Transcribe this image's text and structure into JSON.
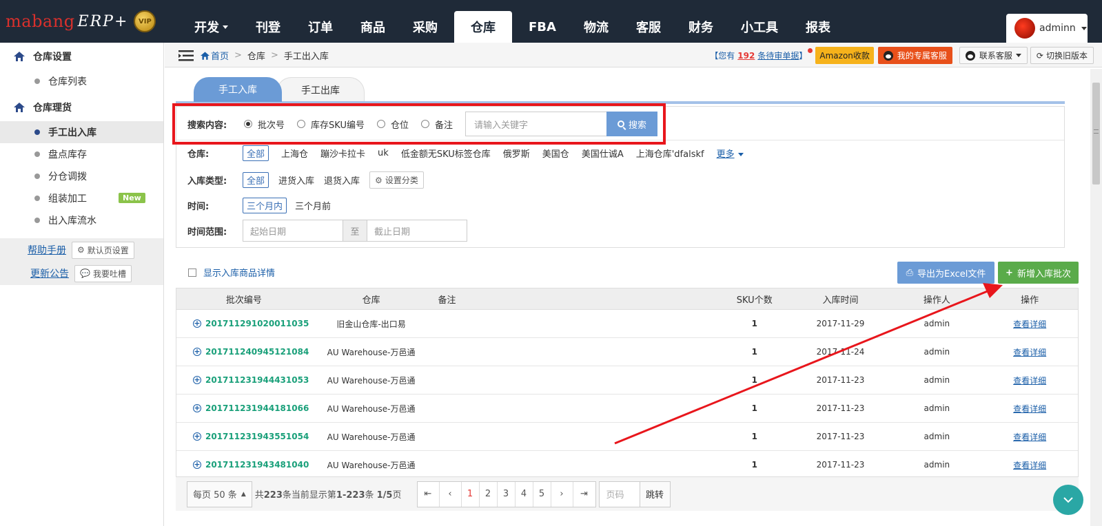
{
  "logo": {
    "brand": "mabang",
    "erp": "ERP+",
    "vip": "VIP"
  },
  "nav": {
    "items": [
      {
        "label": "开发",
        "dropdown": true
      },
      {
        "label": "刊登"
      },
      {
        "label": "订单"
      },
      {
        "label": "商品"
      },
      {
        "label": "采购"
      },
      {
        "label": "仓库",
        "active": true
      },
      {
        "label": "FBA"
      },
      {
        "label": "物流"
      },
      {
        "label": "客服"
      },
      {
        "label": "财务"
      },
      {
        "label": "小工具"
      },
      {
        "label": "报表"
      }
    ],
    "user": "adminn"
  },
  "sidebar": {
    "group1": "仓库设置",
    "group1_items": [
      "仓库列表"
    ],
    "group2": "仓库理货",
    "group2_items": [
      "手工出入库",
      "盘点库存",
      "分仓调拨",
      "组装加工",
      "出入库流水"
    ],
    "new_badge": "New",
    "help": "帮助手册",
    "default_page": "默认页设置",
    "notice": "更新公告",
    "feedback": "我要吐槽"
  },
  "breadcrumb": {
    "home": "首页",
    "level1": "仓库",
    "level2": "手工出入库"
  },
  "topright": {
    "pending_prefix": "【您有",
    "pending_count": "192",
    "pending_suffix": "条待审单据",
    "pending_close": "】",
    "amazon": "Amazon收款",
    "service": "我的专属客服",
    "contact": "联系客服",
    "old_version": "切换旧版本"
  },
  "tabs": {
    "in": "手工入库",
    "out": "手工出库"
  },
  "filters": {
    "search_label": "搜索内容:",
    "search_options": [
      "批次号",
      "库存SKU编号",
      "仓位",
      "备注"
    ],
    "search_selected": "批次号",
    "search_placeholder": "请输入关键字",
    "search_button": "搜索",
    "warehouse_label": "仓库:",
    "warehouses": [
      "全部",
      "上海仓",
      "蹦沙卡拉卡",
      "uk",
      "低金额无SKU标签仓库",
      "俄罗斯",
      "美国仓",
      "美国仕诚A",
      "上海仓库'dfalskf"
    ],
    "warehouse_more": "更多",
    "type_label": "入库类型:",
    "types": [
      "全部",
      "进货入库",
      "退货入库"
    ],
    "type_setting": "设置分类",
    "time_label": "时间:",
    "times": [
      "三个月内",
      "三个月前"
    ],
    "range_label": "时间范围:",
    "start_placeholder": "起始日期",
    "to": "至",
    "end_placeholder": "截止日期"
  },
  "actions": {
    "show_detail": "显示入库商品详情",
    "export": "导出为Excel文件",
    "add_batch": "新增入库批次"
  },
  "table": {
    "columns": [
      "批次编号",
      "仓库",
      "备注",
      "SKU个数",
      "入库时间",
      "操作人",
      "操作"
    ],
    "rows": [
      {
        "batch": "201711291020011035",
        "warehouse": "旧金山仓库-出口易",
        "note": "",
        "sku": "1",
        "time": "2017-11-29",
        "operator": "admin",
        "action": "查看详细"
      },
      {
        "batch": "201711240945121084",
        "warehouse": "AU Warehouse-万邑通",
        "note": "",
        "sku": "1",
        "time": "2017-11-24",
        "operator": "admin",
        "action": "查看详细"
      },
      {
        "batch": "201711231944431053",
        "warehouse": "AU Warehouse-万邑通",
        "note": "",
        "sku": "1",
        "time": "2017-11-23",
        "operator": "admin",
        "action": "查看详细"
      },
      {
        "batch": "201711231944181066",
        "warehouse": "AU Warehouse-万邑通",
        "note": "",
        "sku": "1",
        "time": "2017-11-23",
        "operator": "admin",
        "action": "查看详细"
      },
      {
        "batch": "201711231943551054",
        "warehouse": "AU Warehouse-万邑通",
        "note": "",
        "sku": "1",
        "time": "2017-11-23",
        "operator": "admin",
        "action": "查看详细"
      },
      {
        "batch": "201711231943481040",
        "warehouse": "AU Warehouse-万邑通",
        "note": "",
        "sku": "1",
        "time": "2017-11-23",
        "operator": "admin",
        "action": "查看详细"
      }
    ]
  },
  "pager": {
    "per_page": "每页 50 条",
    "total_pre": "共",
    "total": "223",
    "total_mid": "条当前显示第",
    "range": "1-223",
    "range_mid": "条",
    "page_info": "1/5",
    "page_suffix": "页",
    "pages": [
      "1",
      "2",
      "3",
      "4",
      "5"
    ],
    "current": "1",
    "page_input_placeholder": "页码",
    "go": "跳转"
  },
  "colors": {
    "nav_bg": "#1f2a38",
    "accent_blue": "#6b9bd6",
    "green": "#5aab4a",
    "highlight_red": "#e8161c"
  }
}
